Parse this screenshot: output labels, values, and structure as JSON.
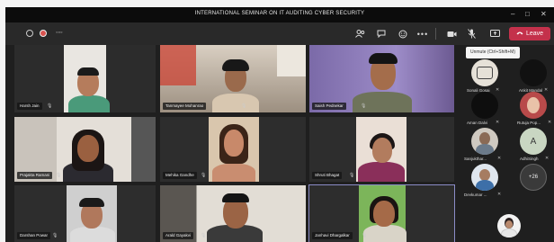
{
  "window": {
    "title": "INTERNATIONAL SEMINAR ON IT AUDITING CYBER SECURITY",
    "min_glyph": "–",
    "max_glyph": "□",
    "close_glyph": "✕"
  },
  "toolbar": {
    "timer": "◦◦◦",
    "leave_label": "Leave",
    "tooltip": "Unmute (Ctrl+Shift+M)"
  },
  "tiles": [
    {
      "name": "Harsh Jain"
    },
    {
      "name": "Tanmayee Mohanrao"
    },
    {
      "name": "Saish Pednekar"
    },
    {
      "name": "Prajakta Ramani"
    },
    {
      "name": "Mehika Gandhe"
    },
    {
      "name": "Shruti Bhagat"
    },
    {
      "name": "Darshan Powar"
    },
    {
      "name": "Arald Gayakvi"
    },
    {
      "name": "Janhavi Dhargalkar"
    }
  ],
  "participants": [
    {
      "name": "Sonali Gosai",
      "initials": ""
    },
    {
      "name": "Ankit Mandal",
      "initials": ""
    },
    {
      "name": "Aman Dalvi",
      "initials": ""
    },
    {
      "name": "Rutuja Pop...",
      "initials": ""
    },
    {
      "name": "Sanjukthar...",
      "initials": ""
    },
    {
      "name": "AdhiSingh",
      "initials": "A"
    },
    {
      "name": "Devkumar ...",
      "initials": ""
    },
    {
      "name": "",
      "initials": "+26"
    }
  ],
  "colors": {
    "leave": "#c4314b",
    "active_outline": "#8b8cc7"
  }
}
